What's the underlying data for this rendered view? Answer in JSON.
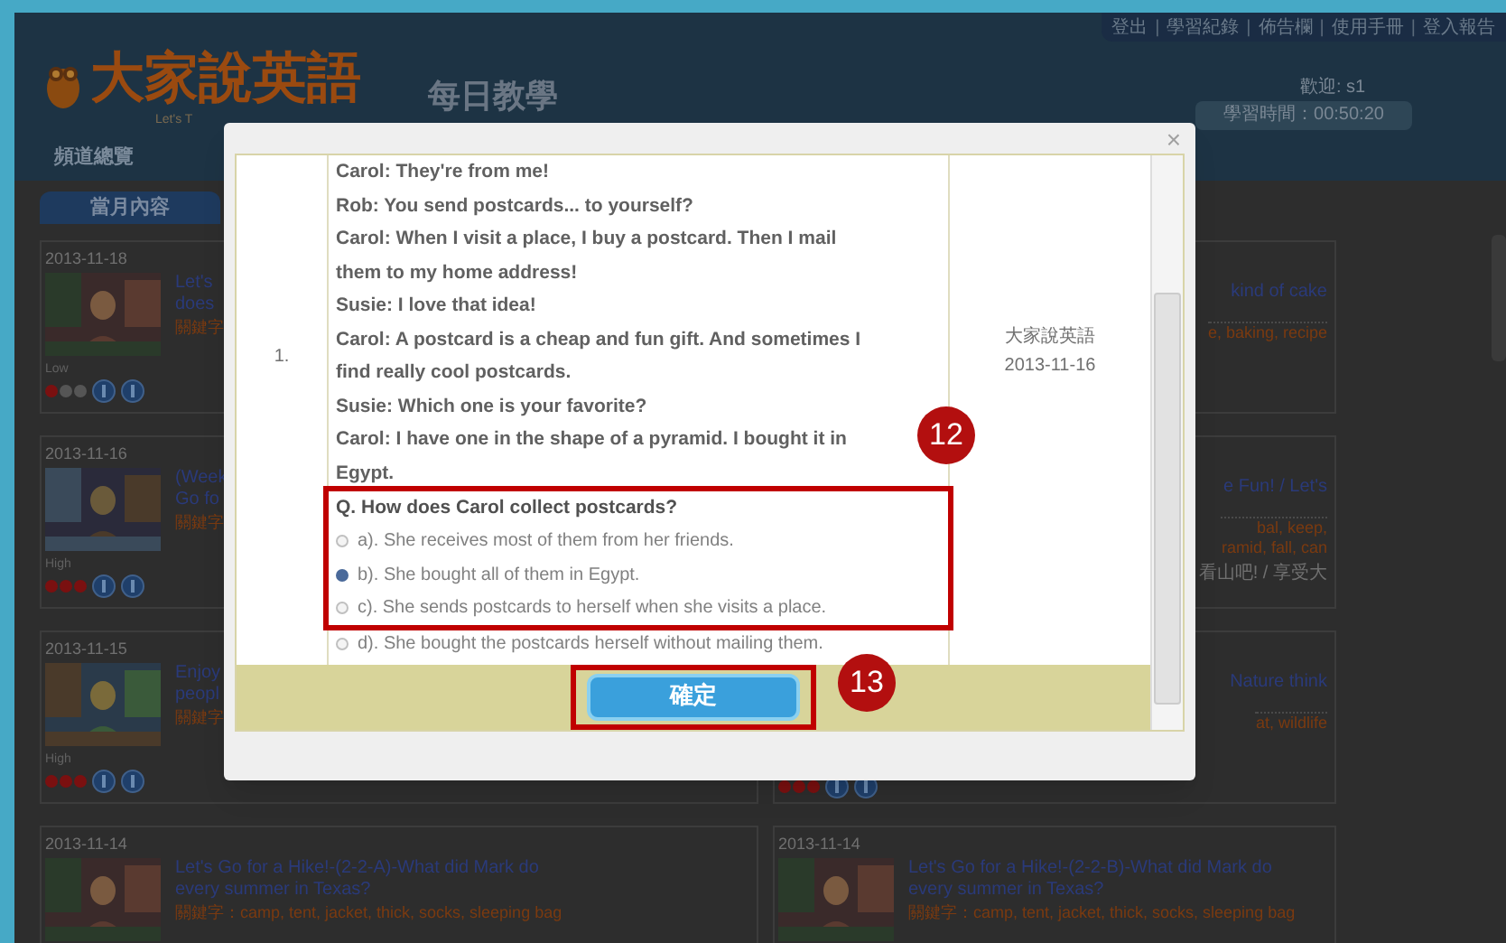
{
  "header": {
    "separator": "|",
    "top_links": [
      "登出",
      "學習紀錄",
      "佈告欄",
      "使用手冊",
      "登入報告"
    ],
    "logo": "大家說英語",
    "logo_subtitle": "Let's T",
    "section_title": "每日教學",
    "welcome": "歡迎: s1",
    "study_time": "學習時間：00:50:20"
  },
  "nav": {
    "items": [
      "頻道總覽"
    ]
  },
  "month_tab": "當月內容",
  "left_cards": [
    {
      "date": "2013-11-18",
      "title_lines": [
        "Let's",
        "does"
      ],
      "keywords": "關鍵字",
      "level": "Low",
      "stars": 1
    },
    {
      "date": "2013-11-16",
      "title_lines": [
        "(Week",
        "Go fo"
      ],
      "keywords": "關鍵字",
      "level": "High",
      "stars": 3
    },
    {
      "date": "2013-11-15",
      "title_lines": [
        "Enjoy",
        "peopl"
      ],
      "keywords": "關鍵字",
      "level": "High",
      "stars": 3
    },
    {
      "date": "2013-11-14",
      "title_lines": [
        "Let's Go for a Hike!-(2-2-A)-What did Mark do",
        "every summer in Texas?"
      ],
      "keywords": "關鍵字：camp, tent, jacket, thick, socks, sleeping bag"
    }
  ],
  "right_cards": [
    {
      "title_lines": [
        "kind of cake"
      ],
      "keyword_lines": [
        "e, baking, recipe"
      ]
    },
    {
      "title_lines": [
        "e Fun! / Let's"
      ],
      "keyword_lines": [
        "bal, keep,",
        "ramid, fall, can"
      ],
      "summary": "看山吧! / 享受大"
    },
    {
      "title_lines": [
        "Nature think"
      ],
      "keyword_lines": [
        "at, wildlife"
      ],
      "stars": 3
    },
    {
      "date": "2013-11-14",
      "title_lines": [
        "Let's Go for a Hike!-(2-2-B)-What did Mark do",
        "every summer in Texas?"
      ],
      "keyword_lines": [
        "關鍵字：camp, tent, jacket, thick, socks, sleeping bag"
      ]
    }
  ],
  "dialog": {
    "rows": [
      {
        "number": "1.",
        "lines": [
          "Carol: They're from me!",
          "Rob: You send postcards... to yourself?",
          "Carol: When I visit a place, I buy a postcard. Then I mail them to my home address!",
          "Susie: I love that idea!",
          "Carol: A postcard is a cheap and fun gift. And sometimes I find really cool postcards.",
          "Susie: Which one is your favorite?",
          "Carol: I have one in the shape of a pyramid. I bought it in Egypt."
        ],
        "question": "Q. How does Carol collect postcards?",
        "options": [
          {
            "label": "a). She receives most of them from her friends.",
            "selected": false
          },
          {
            "label": "b). She bought all of them in Egypt.",
            "selected": true
          },
          {
            "label": "c). She sends postcards to herself when she visits a place.",
            "selected": false
          },
          {
            "label": "d). She bought the postcards herself without mailing them.",
            "selected": false
          }
        ],
        "source": "大家說英語",
        "date": "2013-11-16"
      }
    ],
    "confirm_button": "確定",
    "close_button": "×"
  },
  "annotations": [
    {
      "number": "12"
    },
    {
      "number": "13"
    }
  ]
}
